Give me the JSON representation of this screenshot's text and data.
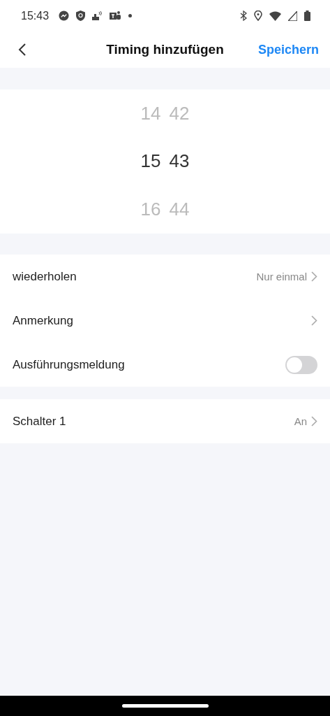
{
  "status_bar": {
    "time": "15:43"
  },
  "nav": {
    "title": "Timing hinzufügen",
    "action": "Speichern"
  },
  "picker": {
    "hours": [
      {
        "value": "14",
        "selected": false
      },
      {
        "value": "15",
        "selected": true
      },
      {
        "value": "16",
        "selected": false
      }
    ],
    "minutes": [
      {
        "value": "42",
        "selected": false
      },
      {
        "value": "43",
        "selected": true
      },
      {
        "value": "44",
        "selected": false
      }
    ]
  },
  "groups": [
    {
      "rows": [
        {
          "kind": "chevron",
          "label": "wiederholen",
          "value": "Nur einmal"
        },
        {
          "kind": "chevron",
          "label": "Anmerkung"
        },
        {
          "kind": "toggle",
          "label": "Ausführungsmeldung",
          "on": false
        }
      ]
    },
    {
      "rows": [
        {
          "kind": "chevron",
          "label": "Schalter 1",
          "value": "An"
        }
      ]
    }
  ]
}
